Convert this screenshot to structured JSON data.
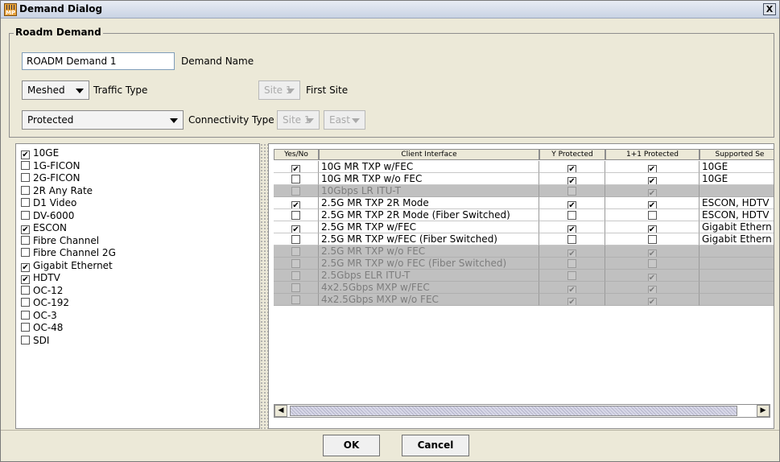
{
  "window": {
    "title": "Demand Dialog",
    "icon": "mp-app-icon",
    "icon_text": "MP"
  },
  "group": {
    "title": "Roadm Demand"
  },
  "fields": {
    "demand_name_value": "ROADM Demand 1",
    "demand_name_label": "Demand Name",
    "traffic_type_value": "Meshed",
    "traffic_type_label": "Traffic Type",
    "first_site_value": "Site 1",
    "first_site_label": "First Site",
    "connectivity_value": "Protected",
    "connectivity_label": "Connectivity Type",
    "connectivity_site_value": "Site 1",
    "connectivity_side_value": "East"
  },
  "services": [
    {
      "label": "10GE",
      "checked": true
    },
    {
      "label": "1G-FICON",
      "checked": false
    },
    {
      "label": "2G-FICON",
      "checked": false
    },
    {
      "label": "2R Any Rate",
      "checked": false
    },
    {
      "label": "D1 Video",
      "checked": false
    },
    {
      "label": "DV-6000",
      "checked": false
    },
    {
      "label": "ESCON",
      "checked": true
    },
    {
      "label": "Fibre Channel",
      "checked": false
    },
    {
      "label": "Fibre Channel 2G",
      "checked": false
    },
    {
      "label": "Gigabit Ethernet",
      "checked": true
    },
    {
      "label": "HDTV",
      "checked": true
    },
    {
      "label": "OC-12",
      "checked": false
    },
    {
      "label": "OC-192",
      "checked": false
    },
    {
      "label": "OC-3",
      "checked": false
    },
    {
      "label": "OC-48",
      "checked": false
    },
    {
      "label": "SDI",
      "checked": false
    }
  ],
  "table": {
    "headers": [
      "Yes/No",
      "Client Interface",
      "Y Protected",
      "1+1 Protected",
      "Supported Se"
    ],
    "rows": [
      {
        "yes": true,
        "interface": "10G MR TXP w/FEC",
        "y_prot": true,
        "one_prot": true,
        "supported": "10GE",
        "disabled": false
      },
      {
        "yes": false,
        "interface": "10G MR TXP w/o FEC",
        "y_prot": true,
        "one_prot": true,
        "supported": "10GE",
        "disabled": false
      },
      {
        "yes": false,
        "interface": "10Gbps LR ITU-T",
        "y_prot": false,
        "one_prot": true,
        "supported": "",
        "disabled": true
      },
      {
        "yes": true,
        "interface": "2.5G MR TXP 2R Mode",
        "y_prot": true,
        "one_prot": true,
        "supported": "ESCON, HDTV",
        "disabled": false
      },
      {
        "yes": false,
        "interface": "2.5G MR TXP 2R Mode (Fiber Switched)",
        "y_prot": false,
        "one_prot": false,
        "supported": "ESCON, HDTV",
        "disabled": false
      },
      {
        "yes": true,
        "interface": "2.5G MR TXP w/FEC",
        "y_prot": true,
        "one_prot": true,
        "supported": "Gigabit Ethern",
        "disabled": false
      },
      {
        "yes": false,
        "interface": "2.5G MR TXP w/FEC (Fiber Switched)",
        "y_prot": false,
        "one_prot": false,
        "supported": "Gigabit Ethern",
        "disabled": false
      },
      {
        "yes": false,
        "interface": "2.5G MR TXP w/o FEC",
        "y_prot": true,
        "one_prot": true,
        "supported": "",
        "disabled": true
      },
      {
        "yes": false,
        "interface": "2.5G MR TXP w/o FEC (Fiber Switched)",
        "y_prot": false,
        "one_prot": false,
        "supported": "",
        "disabled": true
      },
      {
        "yes": false,
        "interface": "2.5Gbps ELR ITU-T",
        "y_prot": false,
        "one_prot": true,
        "supported": "",
        "disabled": true
      },
      {
        "yes": false,
        "interface": "4x2.5Gbps MXP w/FEC",
        "y_prot": true,
        "one_prot": true,
        "supported": "",
        "disabled": true
      },
      {
        "yes": false,
        "interface": "4x2.5Gbps MXP w/o FEC",
        "y_prot": true,
        "one_prot": true,
        "supported": "",
        "disabled": true
      }
    ]
  },
  "buttons": {
    "ok": "OK",
    "cancel": "Cancel",
    "close_glyph": "X",
    "scroll_left": "◀",
    "scroll_right": "▶"
  },
  "check_glyph": "✔"
}
